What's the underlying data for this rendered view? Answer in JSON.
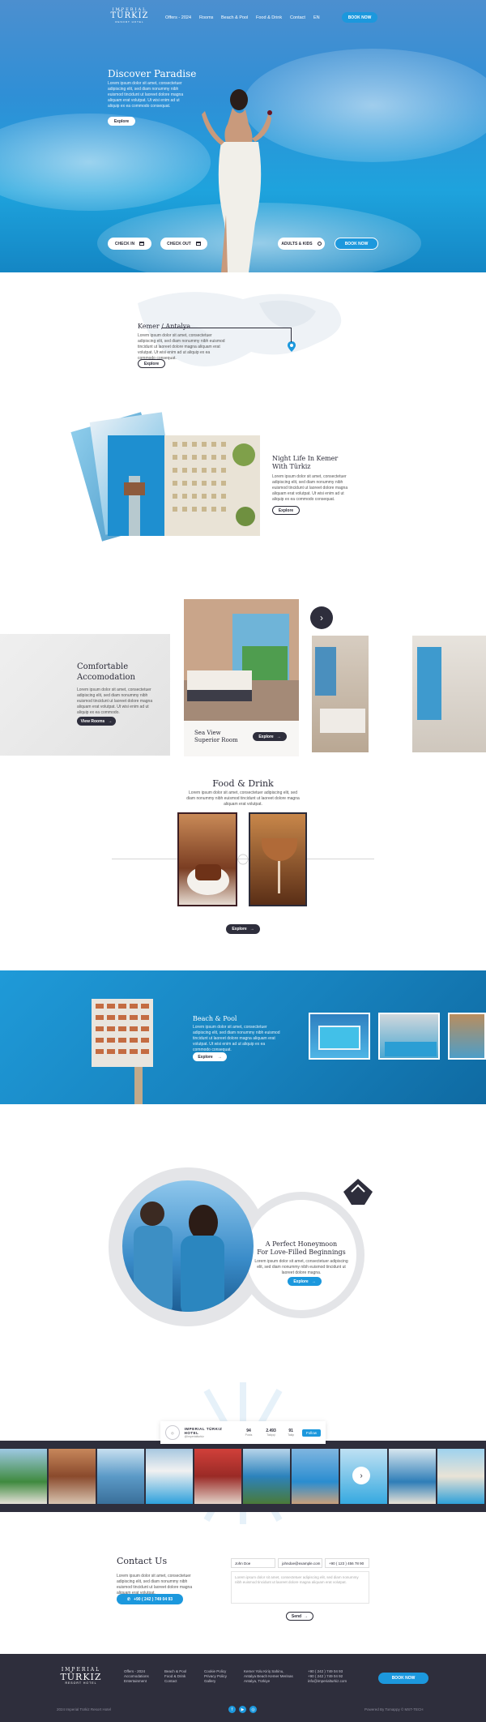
{
  "brand": {
    "name_top": "IMPERIAL",
    "name_main": "TÜRKIZ",
    "name_sub": "RESORT HOTEL"
  },
  "nav": {
    "items": [
      "Offers - 2024",
      "Rooms",
      "Beach & Pool",
      "Food & Drink",
      "Contact",
      "EN"
    ],
    "book_now": "BOOK NOW"
  },
  "hero": {
    "title": "Discover Paradise",
    "text": "Lorem ipsum dolor sit amet, consectetuer adipiscing elit, sed diam nonummy nibh euismod tincidunt ut laoreet dolore magna aliquam erat volutpat. Ut wisi enim ad ut aliquip ex ea commodo consequat.",
    "explore": "Explore",
    "check_in": "CHECK IN",
    "check_out": "CHECK OUT",
    "guests": "ADULTS & KIDS",
    "book_now": "BOOK NOW"
  },
  "location": {
    "title": "Kemer / Antalya",
    "text": "Lorem ipsum dolor sit amet, consectetuer adipiscing elit, sed diam nonummy nibh euismod tincidunt ut laoreet dolore magna aliquam erat volutpat. Ut wisi enim ad ut aliquip ex ea commodo consequat.",
    "explore": "Explore"
  },
  "nightlife": {
    "title_line1": "Night Life In Kemer",
    "title_line2": "With Türkiz",
    "text": "Lorem ipsum dolor sit amet, consectetuer adipiscing elit, sed diam nonummy nibh euismod tincidunt ut laoreet dolore magna aliquam erat volutpat. Ut wisi enim ad ut aliquip ex ea commodo consequat.",
    "explore": "Explore"
  },
  "rooms": {
    "title_line1": "Comfortable",
    "title_line2": "Accomodation",
    "text": "Lorem ipsum dolor sit amet, consectetuer adipiscing elit, sed diam nonummy nibh euismod tincidunt ut laoreet dolore magna aliquam erat volutpat. Ut wisi enim ad ut aliquip ex ea commodo.",
    "view_rooms": "View Rooms",
    "card_title_line1": "Sea View",
    "card_title_line2": "Superior Room",
    "card_explore": "Explore"
  },
  "food": {
    "title": "Food & Drink",
    "text": "Lorem ipsum dolor sit amet, consectetuer adipiscing elit, sed diam nonummy nibh euismod tincidunt ut laoreet dolore magna aliquam erat volutpat.",
    "explore": "Explore"
  },
  "beach": {
    "title": "Beach & Pool",
    "text": "Lorem ipsum dolor sit amet, consectetuer adipiscing elit, sed diam nonummy nibh euismod tincidunt ut laoreet dolore magna aliquam erat volutpat. Ut wisi enim ad ut aliquip ex ea commodo consequat.",
    "explore": "Explore"
  },
  "honeymoon": {
    "title_line1": "A Perfect Honeymoon",
    "title_line2": "For Love-Filled Beginnings",
    "text": "Lorem ipsum dolor sit amet, consectetuer adipiscing elit, sed diam nonummy nibh euismod tincidunt ut laoreet dolore magna.",
    "explore": "Explore"
  },
  "instagram": {
    "account": "IMPERIAL TÜRKIZ HOTEL",
    "handle": "@imperialturkiz",
    "posts": "94",
    "posts_label": "Posts",
    "followers": "2.493",
    "followers_label": "Takipçi",
    "following": "91",
    "following_label": "Takip",
    "follow": "Follow"
  },
  "contact": {
    "title": "Contact Us",
    "text": "Lorem ipsum dolor sit amet, consectetuer adipiscing elit, sed diam nonummy nibh euismod tincidunt ut laoreet dolore magna aliquam erat volutpat.",
    "phone_button": "+90 ( 242 ) 749 04 93",
    "name_value": "John Doe",
    "email_value": "johndoe@example.com",
    "phone_value": "+90 ( 123 ) 456 78 90",
    "message_placeholder": "Lorem ipsum dolor sit amet, consectetuer adipiscing elit, sed diam nonummy nibh euismod tincidunt ut laoreet dolore magna aliquam erat volutpat.",
    "send": "Send"
  },
  "footer": {
    "col1": [
      "Offers - 2024",
      "Accomodations",
      "Entertainment"
    ],
    "col2": [
      "Beach & Pool",
      "Food & Drink",
      "Contact"
    ],
    "col3": [
      "Cookie Policy",
      "Privacy Policy",
      "Gallery"
    ],
    "address": [
      "Kemer Yolu Kiriş Sahinu,",
      "Antalya Beach Kemer Merinas",
      "Antalya, Türkiye"
    ],
    "contacts": [
      "+90 ( 242 ) 749 04 93",
      "+90 ( 242 ) 749 04 92",
      "info@imperialturkiz.com"
    ],
    "book_now": "BOOK NOW",
    "copyright": "2024 Imperial Türkiz Resort Hotel",
    "powered": "Powered By Tomappy © MST-TECH"
  },
  "colors": {
    "accent": "#1c98dd",
    "dark": "#2e2e3c",
    "sea": "#1886c2"
  }
}
